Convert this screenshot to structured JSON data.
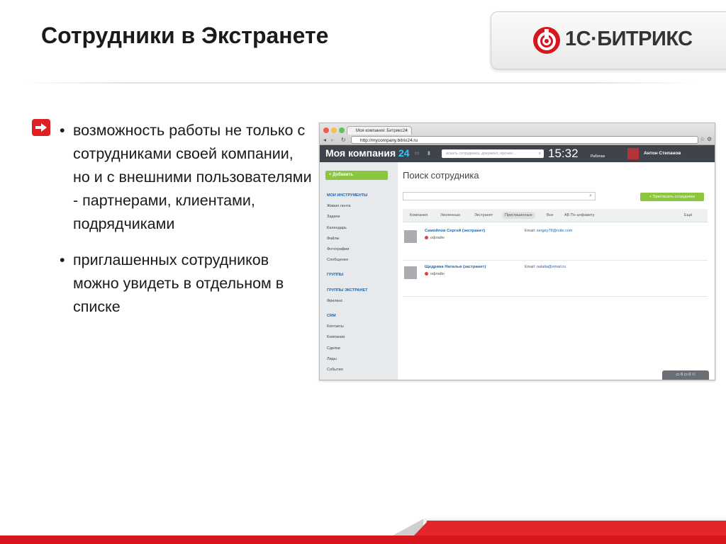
{
  "slide": {
    "title": "Сотрудники в Экстранете",
    "logo_text": "1С·БИТРИКС",
    "bullets": [
      "возможность работы не только с сотрудниками своей компании, но и с внешними пользователями - партнерами, клиентами, подрядчиками",
      "приглашенных сотрудников можно увидеть в отдельном в списке"
    ]
  },
  "browser": {
    "tab_title": "Моя компания: Битрикс24",
    "url": "http://mycompany.bitrix24.ru"
  },
  "portal": {
    "name": "Моя компания",
    "name_accent": "24",
    "search_placeholder": "искать сотрудника, документ, прочее...",
    "clock": "15:32",
    "status": "Работаю",
    "user": "Антон Степанов"
  },
  "sidebar": {
    "add_label": "+ Добавить",
    "items": [
      {
        "label": "МОИ ИНСТРУМЕНТЫ",
        "header": true
      },
      {
        "label": "Живая лента"
      },
      {
        "label": "Задачи"
      },
      {
        "label": "Календарь"
      },
      {
        "label": "Файлы"
      },
      {
        "label": "Фотографии"
      },
      {
        "label": "Сообщения"
      },
      {
        "label": "ГРУППЫ",
        "header": true
      },
      {
        "label": "ГРУППЫ ЭКСТРАНЕТ",
        "header": true
      },
      {
        "label": "Фриланс"
      },
      {
        "label": "CRM",
        "header": true
      },
      {
        "label": "Контакты"
      },
      {
        "label": "Компании"
      },
      {
        "label": "Сделки"
      },
      {
        "label": "Лиды"
      },
      {
        "label": "События"
      }
    ]
  },
  "content": {
    "title": "Поиск сотрудника",
    "invite_label": "+ Пригласить сотрудника",
    "filters": {
      "company": "Компания",
      "fired": "Уволенные",
      "extranet": "Экстранет",
      "invited": "Приглашенные",
      "all": "Все",
      "alpha": "АБ По алфавиту",
      "more": "Ещё"
    },
    "employees": [
      {
        "name": "Самойлов Сергей (экстранет)",
        "status": "офлайн",
        "email_label": "Email:",
        "email": "sergey78@rsite.com"
      },
      {
        "name": "Щедрина Наталья (экстранет)",
        "status": "офлайн",
        "email_label": "Email:",
        "email": "natalia@email.ru"
      }
    ],
    "bottom_bar": "▭ 0   ▭ 0   ⚇"
  }
}
